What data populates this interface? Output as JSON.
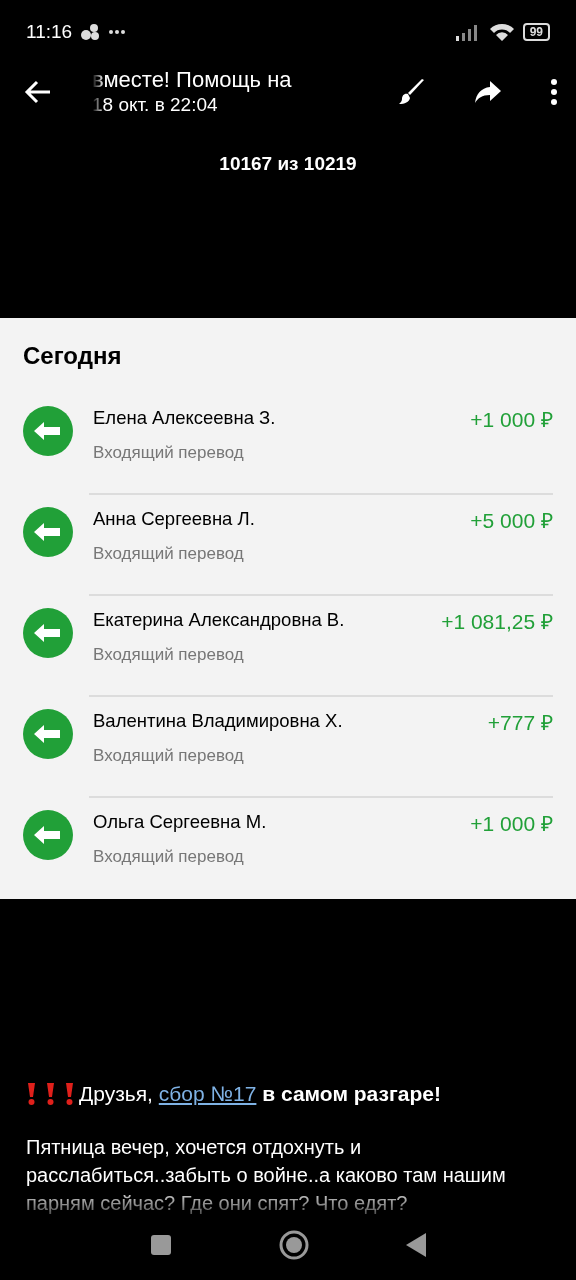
{
  "status_bar": {
    "time": "11:16",
    "battery": "99"
  },
  "header": {
    "title": "вместе! Помощь на",
    "subtitle": "18 окт. в 22:04"
  },
  "counter": "10167 из 10219",
  "statement": {
    "section": "Сегодня",
    "transactions": [
      {
        "name": "Елена Алексеевна З.",
        "type": "Входящий перевод",
        "amount": "+1 000 ₽"
      },
      {
        "name": "Анна Сергеевна Л.",
        "type": "Входящий перевод",
        "amount": "+5 000 ₽"
      },
      {
        "name": "Екатерина Александровна В.",
        "type": "Входящий перевод",
        "amount": "+1 081,25 ₽"
      },
      {
        "name": "Валентина Владимировна Х.",
        "type": "Входящий перевод",
        "amount": "+777 ₽"
      },
      {
        "name": "Ольга Сергеевна М.",
        "type": "Входящий перевод",
        "amount": "+1 000 ₽"
      }
    ]
  },
  "post": {
    "headline": {
      "before": "Друзья,",
      "link": "сбор №17",
      "after": "**в самом разгаре!**"
    },
    "body": "Пятница вечер, хочется отдохнуть и расслабиться..забыть о войне..а каково там нашим парням сейчас? Где они спят? Что едят?"
  }
}
